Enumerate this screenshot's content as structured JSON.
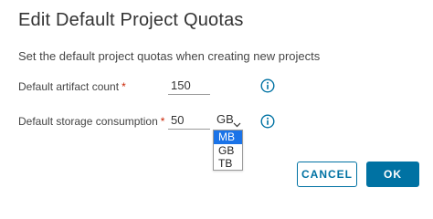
{
  "dialog": {
    "title": "Edit Default Project Quotas",
    "subtitle": "Set the default project quotas when creating new projects"
  },
  "fields": {
    "artifact_count": {
      "label": "Default artifact count",
      "required_mark": "*",
      "value": "150"
    },
    "storage": {
      "label": "Default storage consumption",
      "required_mark": "*",
      "value": "50",
      "unit_selected": "GB",
      "unit_options": [
        "MB",
        "GB",
        "TB"
      ],
      "highlighted_option": "MB"
    }
  },
  "buttons": {
    "cancel": "CANCEL",
    "ok": "OK"
  },
  "colors": {
    "accent": "#0072a3",
    "info_icon": "#0072a3",
    "required": "#c92100",
    "option_highlight": "#1a73e8"
  },
  "icons": {
    "info": "info-circle-icon",
    "chevron": "chevron-down-icon"
  }
}
